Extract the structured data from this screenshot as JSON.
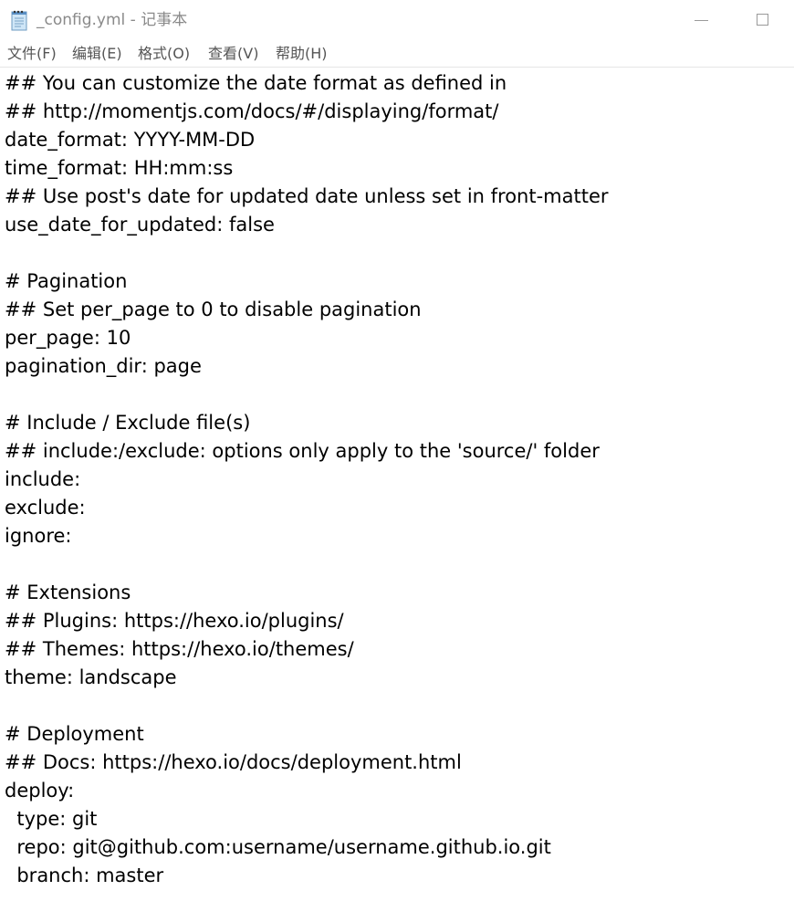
{
  "window": {
    "title": "_config.yml - 记事本",
    "icon": "notepad-icon"
  },
  "menu": {
    "items": [
      "文件(F)",
      "编辑(E)",
      "格式(O)",
      "查看(V)",
      "帮助(H)"
    ]
  },
  "editor": {
    "lines": [
      "## You can customize the date format as defined in",
      "## http://momentjs.com/docs/#/displaying/format/",
      "date_format: YYYY-MM-DD",
      "time_format: HH:mm:ss",
      "## Use post's date for updated date unless set in front-matter",
      "use_date_for_updated: false",
      "",
      "# Pagination",
      "## Set per_page to 0 to disable pagination",
      "per_page: 10",
      "pagination_dir: page",
      "",
      "# Include / Exclude file(s)",
      "## include:/exclude: options only apply to the 'source/' folder",
      "include:",
      "exclude:",
      "ignore:",
      "",
      "# Extensions",
      "## Plugins: https://hexo.io/plugins/",
      "## Themes: https://hexo.io/themes/",
      "theme: landscape",
      "",
      "# Deployment",
      "## Docs: https://hexo.io/docs/deployment.html",
      "deploy:",
      "  type: git",
      "  repo: git@github.com:username/username.github.io.git",
      "  branch: master"
    ]
  },
  "colors": {
    "title_text": "#8a8a8a",
    "menu_text": "#555555",
    "editor_text": "#000000",
    "background": "#ffffff"
  }
}
